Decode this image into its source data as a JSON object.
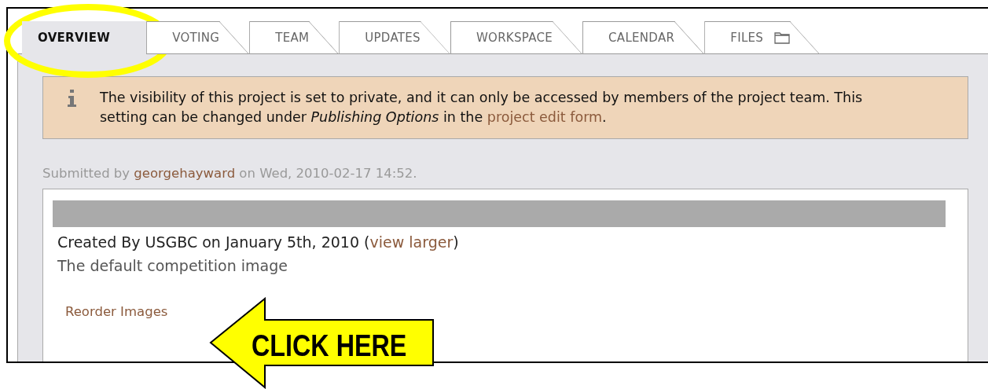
{
  "tabs": [
    {
      "label": "OVERVIEW",
      "selected": true,
      "kind": "plain"
    },
    {
      "label": "VOTING",
      "selected": false,
      "kind": "plain"
    },
    {
      "label": "TEAM",
      "selected": false,
      "kind": "plain"
    },
    {
      "label": "UPDATES",
      "selected": false,
      "kind": "plain"
    },
    {
      "label": "WORKSPACE",
      "selected": false,
      "kind": "plain"
    },
    {
      "label": "CALENDAR",
      "selected": false,
      "kind": "plain"
    },
    {
      "label": "FILES",
      "selected": false,
      "kind": "folder"
    }
  ],
  "notice": {
    "text": "The visibility of this project is set to private, and it can only be accessed by members of the project team. This setting can be changed under *Publishing Options* in the",
    "link": "project edit form",
    "end": "."
  },
  "submitted": {
    "prefix": "Submitted by",
    "author": "georgehayward",
    "suffix": "on Wed, 2010-02-17 14:52."
  },
  "image_card": {
    "caption_prefix": "Created By USGBC on January 5th, 2010 (",
    "caption_link": "view larger",
    "caption_suffix": ")",
    "description": "The default competition image",
    "reorder_link": "Reorder Images"
  },
  "callout": {
    "label": "CLICK HERE"
  }
}
